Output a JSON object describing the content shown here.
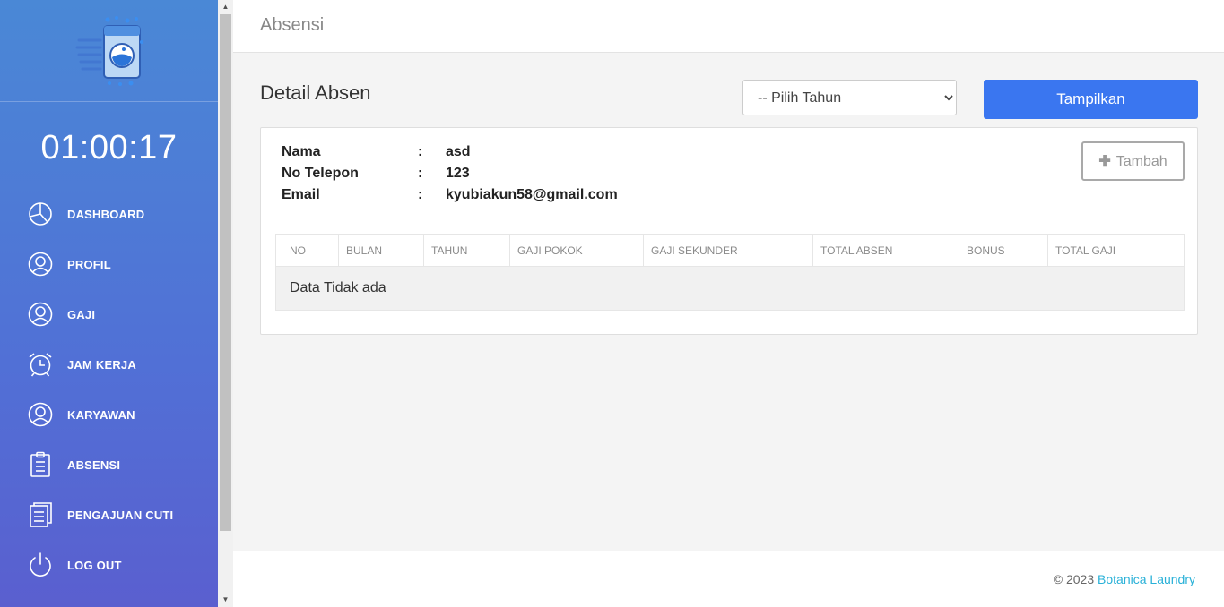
{
  "sidebar": {
    "clock": "01:00:17",
    "items": [
      {
        "label": "DASHBOARD",
        "icon": "pie-chart-icon"
      },
      {
        "label": "PROFIL",
        "icon": "user-circle-icon"
      },
      {
        "label": "GAJI",
        "icon": "user-circle-icon"
      },
      {
        "label": "JAM KERJA",
        "icon": "alarm-clock-icon"
      },
      {
        "label": "KARYAWAN",
        "icon": "user-circle-icon"
      },
      {
        "label": "ABSENSI",
        "icon": "clipboard-icon"
      },
      {
        "label": "PENGAJUAN CUTI",
        "icon": "document-icon"
      },
      {
        "label": "LOG OUT",
        "icon": "power-icon"
      }
    ]
  },
  "header": {
    "title": "Absensi"
  },
  "main": {
    "title": "Detail Absen",
    "year_select": {
      "selected": "-- Pilih Tahun"
    },
    "show_button": "Tampilkan",
    "add_button": "Tambah",
    "info": [
      {
        "key": "Nama",
        "sep": ":",
        "value": "asd"
      },
      {
        "key": "No Telepon",
        "sep": ":",
        "value": "123"
      },
      {
        "key": "Email",
        "sep": ":",
        "value": "kyubiakun58@gmail.com"
      }
    ],
    "table": {
      "columns": [
        "NO",
        "BULAN",
        "TAHUN",
        "GAJI POKOK",
        "GAJI SEKUNDER",
        "TOTAL ABSEN",
        "BONUS",
        "TOTAL GAJI"
      ],
      "empty_text": "Data Tidak ada"
    }
  },
  "footer": {
    "copyright": "© 2023",
    "brand": "Botanica Laundry"
  },
  "colors": {
    "primary": "#3a76f0",
    "sidebar_top": "#4a88d6",
    "sidebar_bottom": "#5a5fcf",
    "link": "#2ab1d8"
  }
}
